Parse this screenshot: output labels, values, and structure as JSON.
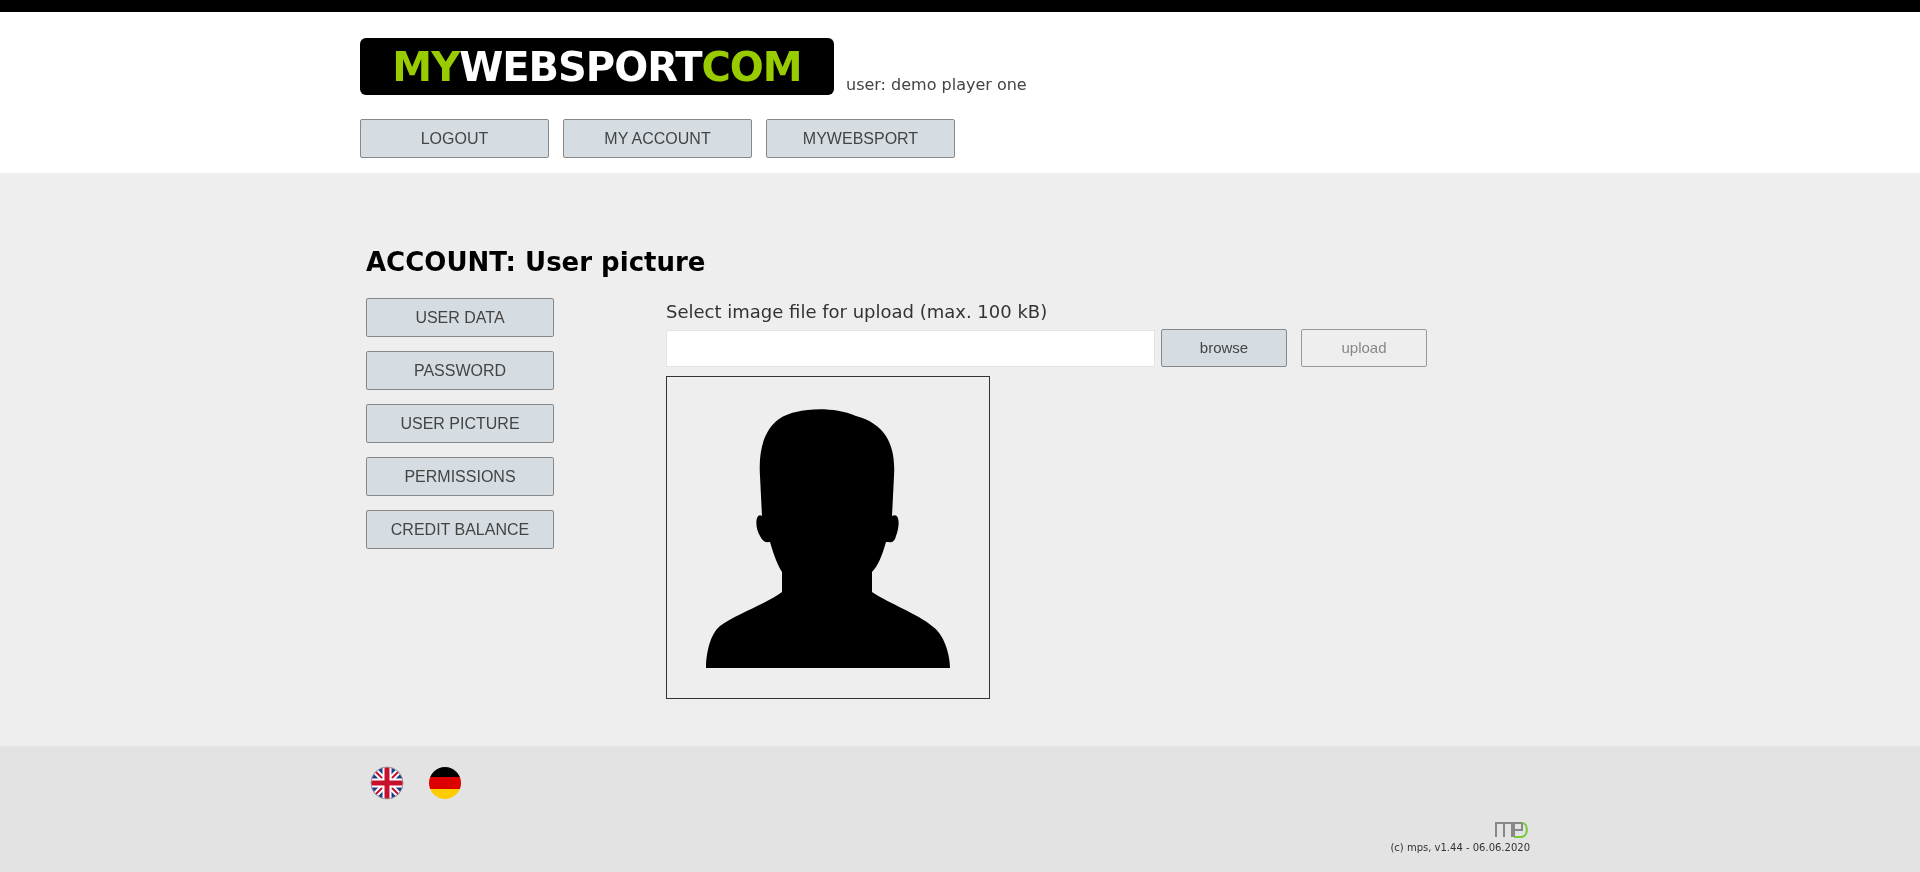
{
  "header": {
    "logo": [
      {
        "text": "MY",
        "accent": true
      },
      {
        "text": "WEBSPORT",
        "accent": false
      },
      {
        "text": "COM",
        "accent": true
      }
    ],
    "user": "user: demo player one",
    "nav": [
      "LOGOUT",
      "MY ACCOUNT",
      "MYWEBSPORT"
    ]
  },
  "page": {
    "title": "ACCOUNT: User picture",
    "menu": [
      {
        "label": "USER DATA",
        "selected": false
      },
      {
        "label": "PASSWORD",
        "selected": false
      },
      {
        "label": "USER PICTURE",
        "selected": false
      },
      {
        "label": "PERMISSIONS",
        "selected": false
      },
      {
        "label": "CREDIT BALANCE",
        "selected": false
      }
    ],
    "upload": {
      "label": "Select image file for upload (max. 100 kB)",
      "buttons": [
        {
          "label": "browse",
          "disabled": false
        },
        {
          "label": "upload",
          "disabled": true
        }
      ]
    }
  },
  "footer": {
    "languages": [
      {
        "kind": "uk"
      },
      {
        "kind": "de"
      }
    ],
    "copyright": "(c) mps, v1.44 - 06.06.2020"
  }
}
